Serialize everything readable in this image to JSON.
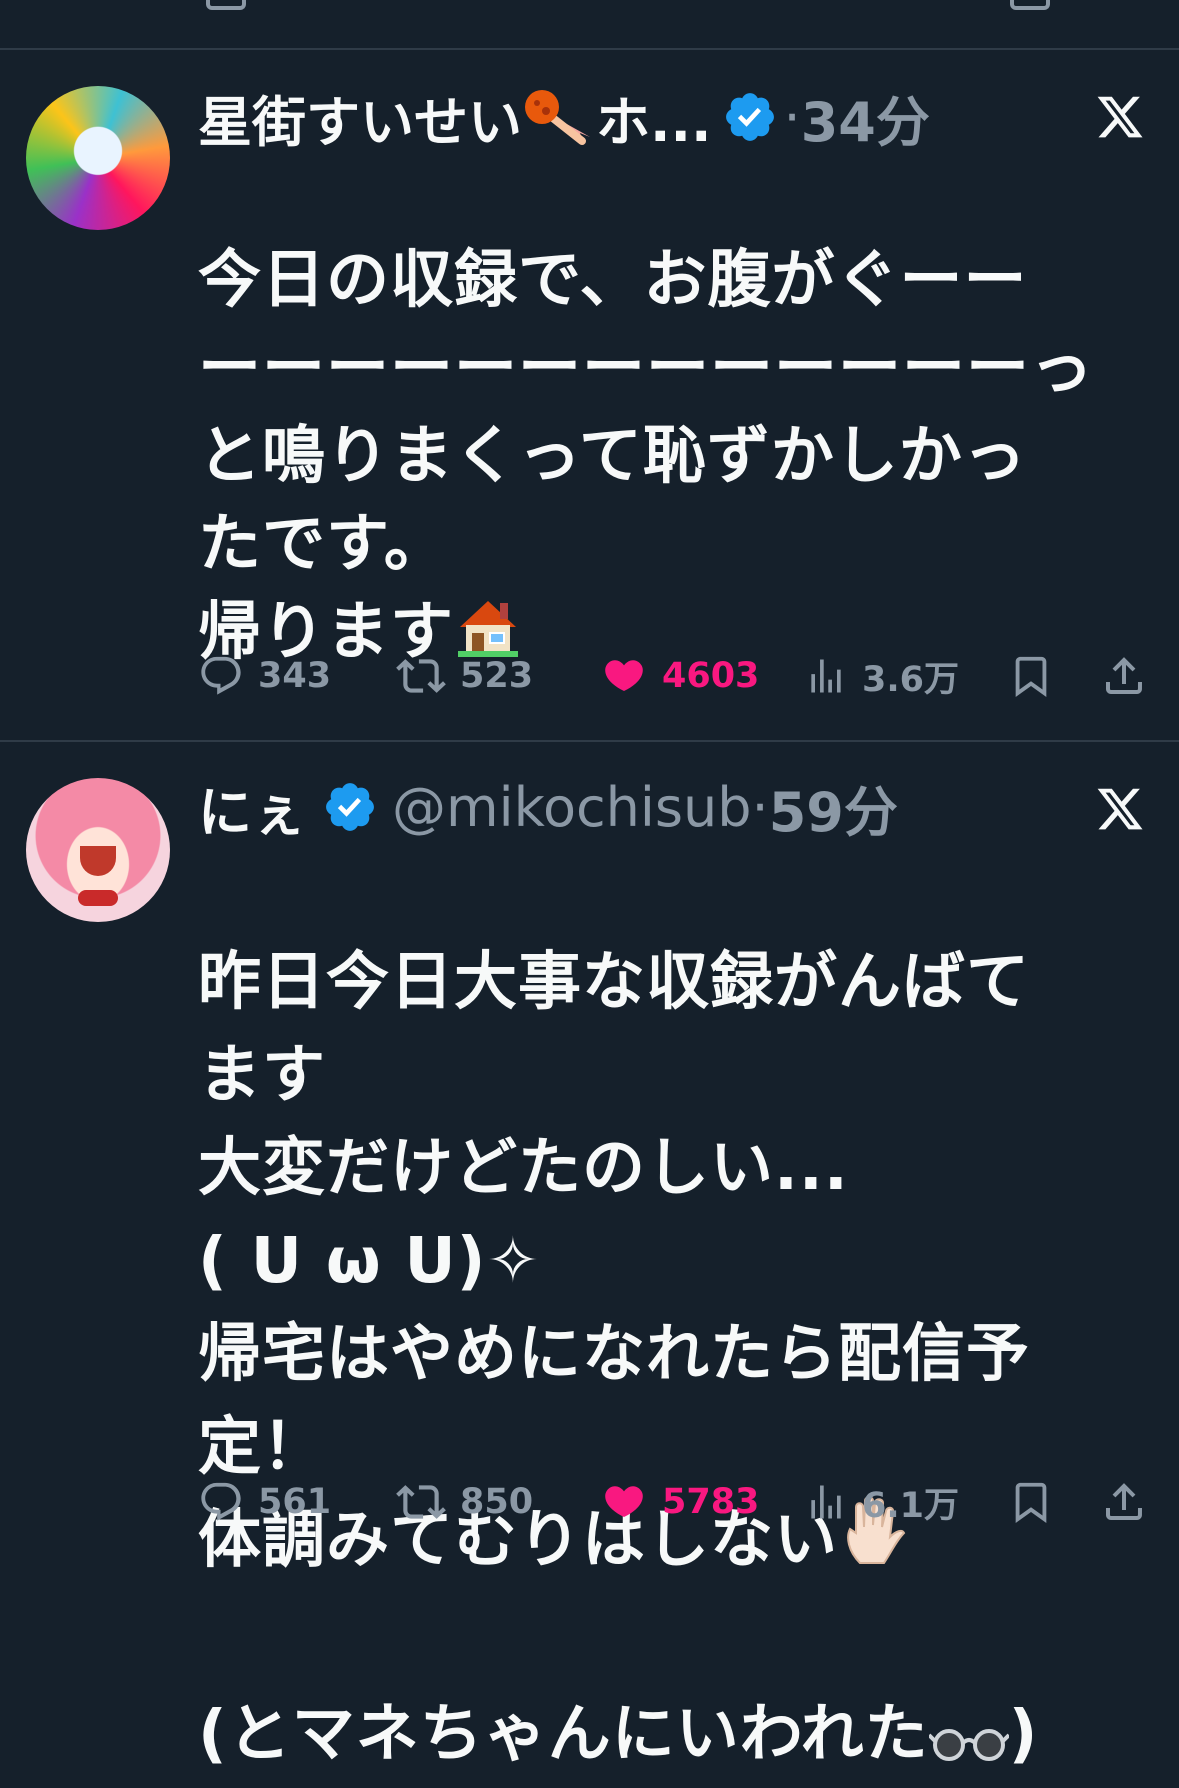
{
  "colors": {
    "background": "#15202b",
    "divider": "#2f3b47",
    "text_primary": "#f7f9f9",
    "text_secondary": "#8b98a5",
    "verified": "#1d9bf0",
    "like": "#f91880"
  },
  "tweets": [
    {
      "display_name": "星街すいせい",
      "name_suffix": "ホ...",
      "name_emoji": "meteor-emoji",
      "handle": "",
      "verified": true,
      "separator": "·",
      "time": "34分",
      "body": "今日の収録で、お腹がぐーー\nーーーーーーーーーーーーーっ\nと鳴りまくって恥ずかしかっ\nたです。\n帰ります",
      "body_end_emoji": "house-emoji",
      "stats": {
        "replies": "343",
        "reposts": "523",
        "likes": "4603",
        "views": "3.6万"
      },
      "liked": true
    },
    {
      "display_name": "にぇ",
      "name_suffix": "",
      "handle": "@mikochisub",
      "verified": true,
      "separator": "·",
      "time": "59分",
      "body": "昨日今日大事な収録がんばて\nます\n大変だけどたのしい...\n( ᑌ ω ᑌ)✧\n帰宅はやめになれたら配信予\n定！\n体調みてむりはしない",
      "body_emoji_1": "raised-hand-emoji",
      "body_tail": "(とマネちゃんにいわれた",
      "body_emoji_2": "glasses-emoji",
      "body_tail_end": ")",
      "stats": {
        "replies": "561",
        "reposts": "850",
        "likes": "5783",
        "views": "6.1万"
      },
      "liked": true
    }
  ],
  "icons": {
    "reply": "reply-icon",
    "repost": "repost-icon",
    "like": "heart-icon",
    "views": "views-icon",
    "bookmark": "bookmark-icon",
    "share": "share-icon",
    "grok": "x-grok-icon"
  }
}
